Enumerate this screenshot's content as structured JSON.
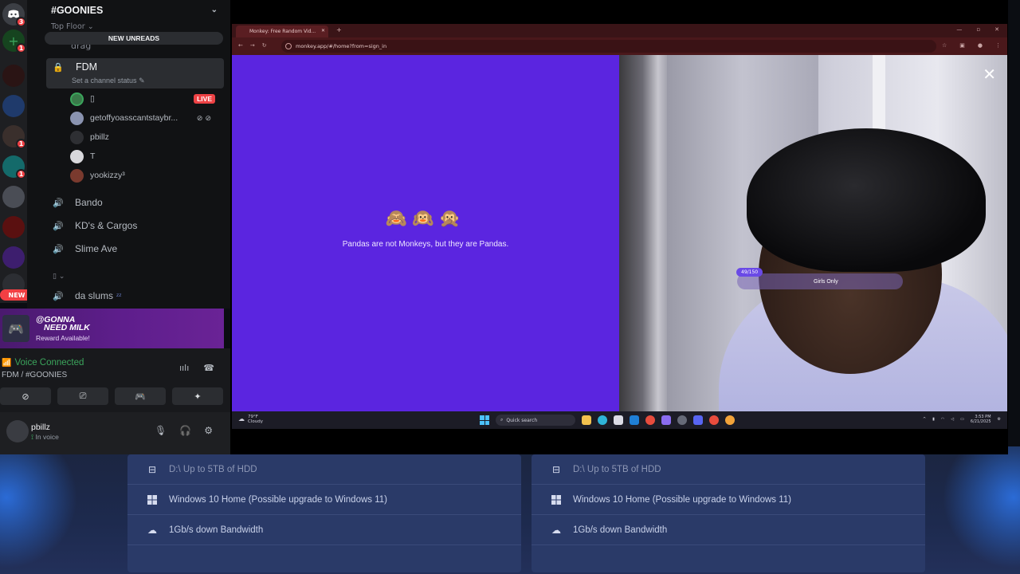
{
  "server": {
    "name": "#GOONIES",
    "top_category": "Top Floor",
    "new_unreads_label": "NEW UNREADS",
    "drag_channel": "drag",
    "rail_badges": [
      "3",
      "1",
      "1",
      "1",
      "1"
    ],
    "new_pill": "NEW"
  },
  "channels": {
    "active": {
      "name": "FDM",
      "status": "Set a channel status"
    },
    "voice_users": [
      {
        "name": "▯",
        "live": "LIVE"
      },
      {
        "name": "getoffyoasscantstaybr..."
      },
      {
        "name": "pbillz"
      },
      {
        "name": "T"
      },
      {
        "name": "yookizzy³"
      }
    ],
    "others": [
      "Bando",
      "KD's & Cargos",
      "Slime Ave"
    ],
    "collapsed_category": "▯",
    "last": "da slums"
  },
  "promo": {
    "line1": "@GONNA",
    "line2": "NEED MILK",
    "reward": "Reward Available!"
  },
  "voice": {
    "status": "Voice Connected",
    "location": "FDM / #GOONIES"
  },
  "user": {
    "name": "pbillz",
    "status": "In voice"
  },
  "browser": {
    "tab_title": "Monkey: Free Random Vid...",
    "url": "monkey.app/#/home?from=sign_in",
    "emojis": "🙈🙉🙊",
    "tagline": "Pandas are not Monkeys, but they are Pandas.",
    "close_glyph": "✕",
    "counter": "49/150",
    "tag_label": "Girls Only"
  },
  "taskbar": {
    "temp": "79°F",
    "weather": "Cloudy",
    "search_placeholder": "Quick search",
    "time": "3:53 PM",
    "date": "6/21/2025"
  },
  "website": {
    "left": [
      {
        "icon": "drive-icon",
        "text": "D:\\ Up to 5TB of HDD",
        "dim": true
      },
      {
        "icon": "windows-icon",
        "text": "Windows 10 Home (Possible upgrade to Windows 11)"
      },
      {
        "icon": "download-cloud-icon",
        "text": "1Gb/s down Bandwidth"
      }
    ],
    "right": [
      {
        "icon": "drive-icon",
        "text": "D:\\ Up to 5TB of HDD",
        "dim": true
      },
      {
        "icon": "windows-icon",
        "text": "Windows 10 Home (Possible upgrade to Windows 11)"
      },
      {
        "icon": "download-cloud-icon",
        "text": "1Gb/s down Bandwidth"
      }
    ]
  },
  "colors": {
    "accent_purple": "#5b25e0",
    "live_red": "#ed4245",
    "voice_green": "#3ba55c"
  }
}
